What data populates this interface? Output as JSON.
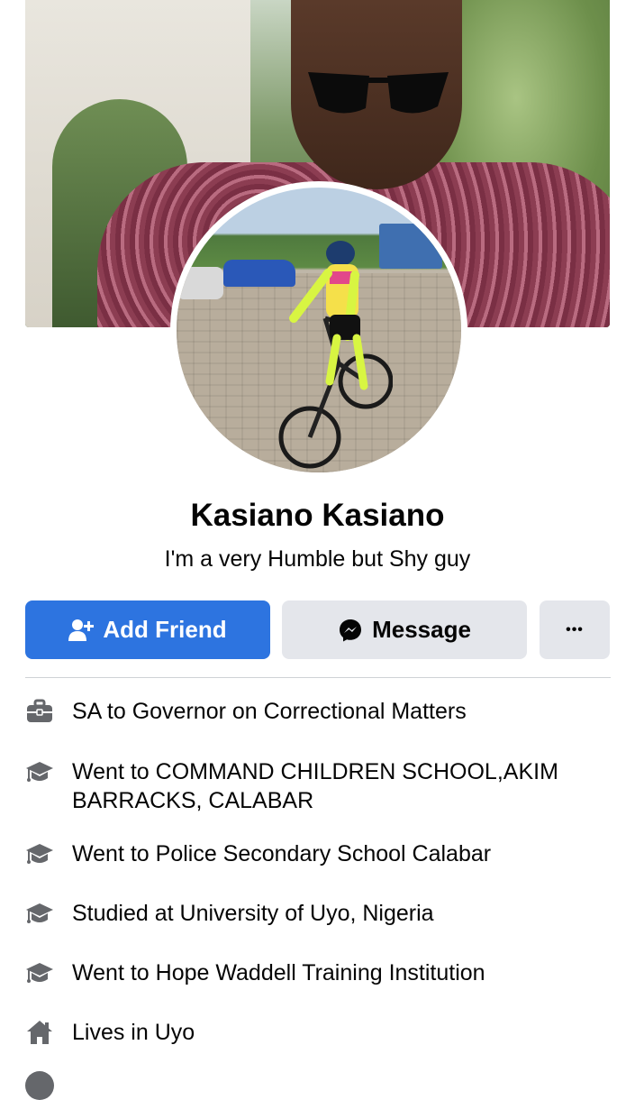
{
  "profile": {
    "name": "Kasiano Kasiano",
    "bio": "I'm a very Humble but Shy guy"
  },
  "actions": {
    "add_friend_label": "Add Friend",
    "message_label": "Message",
    "more_label": "•••"
  },
  "intro": [
    {
      "icon": "briefcase-icon",
      "prefix": "SA to Governor on Correctional Matters",
      "value": ""
    },
    {
      "icon": "graduation-cap-icon",
      "prefix": "Went to ",
      "value": "COMMAND CHILDREN SCHOOL,AKIM BARRACKS, CALABAR"
    },
    {
      "icon": "graduation-cap-icon",
      "prefix": "Went to Police Secondary School Calabar",
      "value": ""
    },
    {
      "icon": "graduation-cap-icon",
      "prefix": "Studied at University of Uyo, Nigeria",
      "value": ""
    },
    {
      "icon": "graduation-cap-icon",
      "prefix": "Went to Hope Waddell Training Institution",
      "value": ""
    },
    {
      "icon": "home-icon",
      "prefix": "Lives in ",
      "value": "Uyo"
    }
  ],
  "colors": {
    "primary_button": "#2d74e0",
    "secondary_button": "#e4e6eb",
    "icon_gray": "#65676b",
    "text": "#050505"
  }
}
